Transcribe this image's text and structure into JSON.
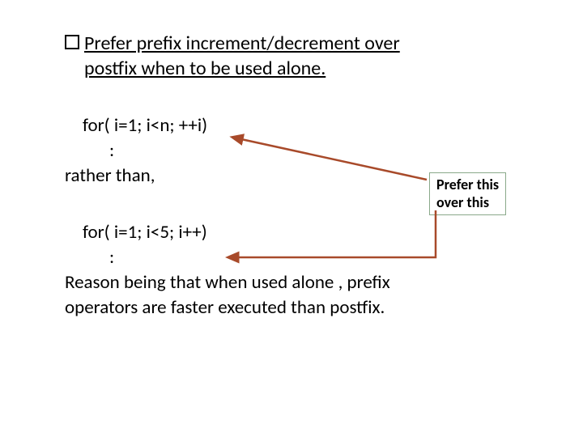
{
  "title_line1": "Prefer prefix increment/decrement over",
  "title_line2": "postfix when to be used alone.",
  "code1": "for( i=1; i<n; ++i)",
  "code1_body": ":",
  "rather": "rather than,",
  "code2": "for( i=1; i<5; i++)",
  "code2_body": ":",
  "reason_line1": "Reason being that when used alone , prefix",
  "reason_line2": "operators are faster executed than postfix.",
  "callout_line1": "Prefer this",
  "callout_line2": "over this"
}
